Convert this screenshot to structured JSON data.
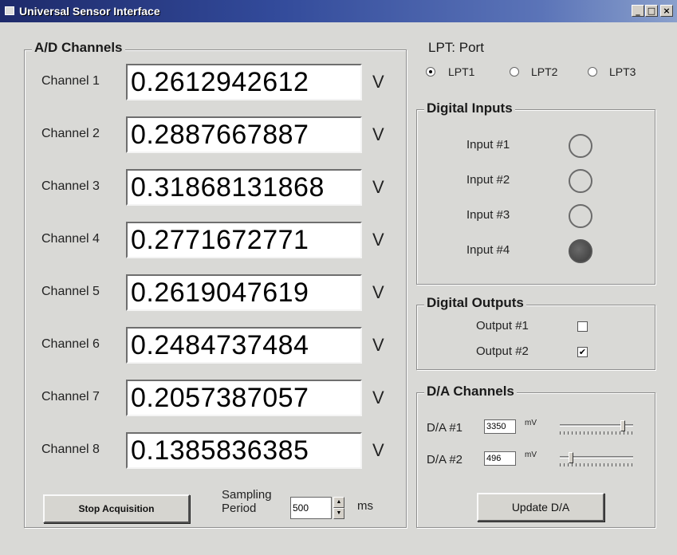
{
  "window": {
    "title": "Universal Sensor Interface",
    "controls": {
      "minimize": "_",
      "maximize": "□",
      "close": "×"
    }
  },
  "ad": {
    "title": "A/D Channels",
    "channels": [
      {
        "label": "Channel 1",
        "value": "0.2612942612",
        "unit": "V"
      },
      {
        "label": "Channel 2",
        "value": "0.2887667887",
        "unit": "V"
      },
      {
        "label": "Channel 3",
        "value": "0.31868131868",
        "unit": "V"
      },
      {
        "label": "Channel 4",
        "value": "0.2771672771",
        "unit": "V"
      },
      {
        "label": "Channel 5",
        "value": "0.2619047619",
        "unit": "V"
      },
      {
        "label": "Channel 6",
        "value": "0.2484737484",
        "unit": "V"
      },
      {
        "label": "Channel 7",
        "value": "0.2057387057",
        "unit": "V"
      },
      {
        "label": "Channel 8",
        "value": "0.1385836385",
        "unit": "V"
      }
    ],
    "stop_button": "Stop Acquisition",
    "sampling": {
      "label_line1": "Sampling",
      "label_line2": "Period",
      "value": "500",
      "unit": "ms"
    }
  },
  "lpt": {
    "title": "LPT: Port",
    "options": [
      {
        "label": "LPT1",
        "selected": true
      },
      {
        "label": "LPT2",
        "selected": false
      },
      {
        "label": "LPT3",
        "selected": false
      }
    ]
  },
  "digital_inputs": {
    "title": "Digital Inputs",
    "items": [
      {
        "label": "Input #1",
        "on": false
      },
      {
        "label": "Input #2",
        "on": false
      },
      {
        "label": "Input #3",
        "on": false
      },
      {
        "label": "Input #4",
        "on": true
      }
    ]
  },
  "digital_outputs": {
    "title": "Digital Outputs",
    "items": [
      {
        "label": "Output #1",
        "checked": false
      },
      {
        "label": "Output #2",
        "checked": true,
        "mark": "✔"
      }
    ]
  },
  "da": {
    "title": "D/A Channels",
    "channels": [
      {
        "label": "D/A #1",
        "value": "3350",
        "unit": "mV",
        "slider_fraction": 0.88
      },
      {
        "label": "D/A #2",
        "value": "496",
        "unit": "mV",
        "slider_fraction": 0.13
      }
    ],
    "update_button": "Update D/A"
  },
  "colors": {
    "window_bg": "#d9d9d6",
    "titlebar": "#1e2a6a",
    "led_on": "#4a4a4a"
  }
}
